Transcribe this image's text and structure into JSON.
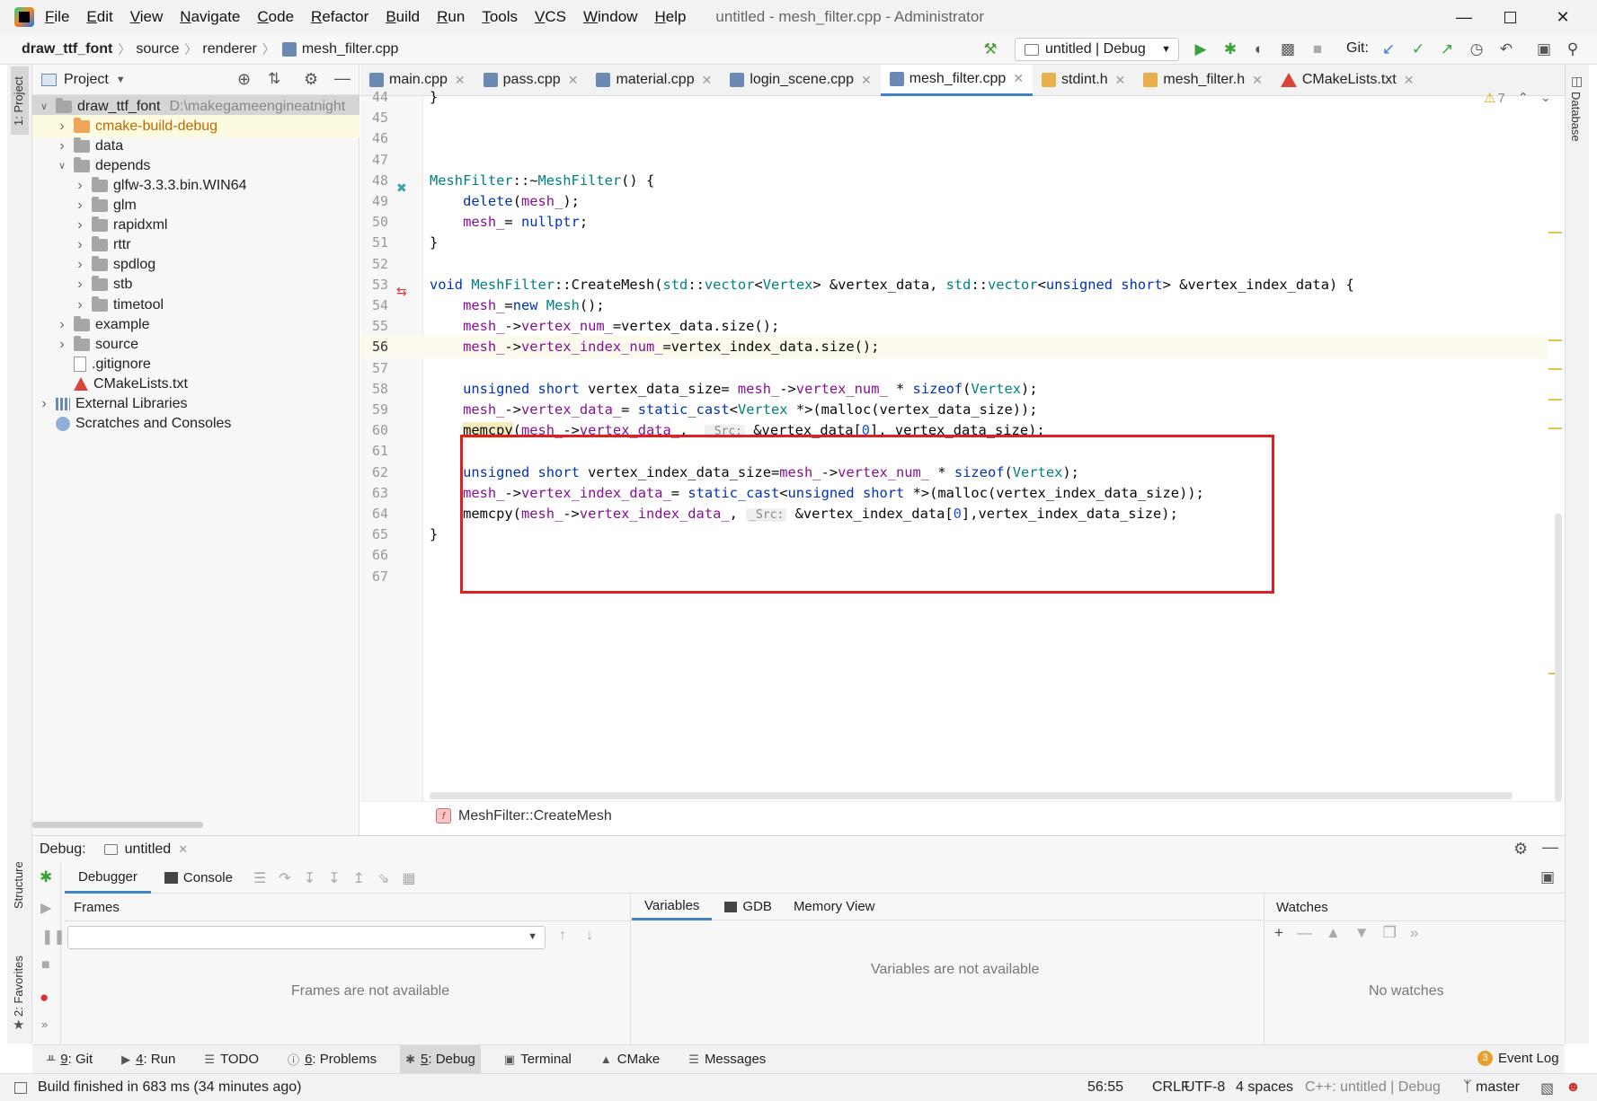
{
  "menu": [
    "File",
    "Edit",
    "View",
    "Navigate",
    "Code",
    "Refactor",
    "Build",
    "Run",
    "Tools",
    "VCS",
    "Window",
    "Help"
  ],
  "window_title": "untitled - mesh_filter.cpp - Administrator",
  "breadcrumbs": [
    "draw_ttf_font",
    "source",
    "renderer",
    "mesh_filter.cpp"
  ],
  "run_config": "untitled | Debug",
  "git_label": "Git:",
  "project_panel": {
    "title": "Project",
    "tree": [
      {
        "label": "draw_ttf_font",
        "path": "D:\\makegameengineatnight",
        "level": 0,
        "open": true,
        "kind": "root"
      },
      {
        "label": "cmake-build-debug",
        "level": 1,
        "open": false,
        "kind": "orange"
      },
      {
        "label": "data",
        "level": 1,
        "open": false,
        "kind": "folder"
      },
      {
        "label": "depends",
        "level": 1,
        "open": true,
        "kind": "folder"
      },
      {
        "label": "glfw-3.3.3.bin.WIN64",
        "level": 2,
        "open": false,
        "kind": "folder"
      },
      {
        "label": "glm",
        "level": 2,
        "open": false,
        "kind": "folder"
      },
      {
        "label": "rapidxml",
        "level": 2,
        "open": false,
        "kind": "folder"
      },
      {
        "label": "rttr",
        "level": 2,
        "open": false,
        "kind": "folder"
      },
      {
        "label": "spdlog",
        "level": 2,
        "open": false,
        "kind": "folder"
      },
      {
        "label": "stb",
        "level": 2,
        "open": false,
        "kind": "folder"
      },
      {
        "label": "timetool",
        "level": 2,
        "open": false,
        "kind": "folder"
      },
      {
        "label": "example",
        "level": 1,
        "open": false,
        "kind": "folder"
      },
      {
        "label": "source",
        "level": 1,
        "open": false,
        "kind": "folder"
      },
      {
        "label": ".gitignore",
        "level": 1,
        "kind": "file"
      },
      {
        "label": "CMakeLists.txt",
        "level": 1,
        "kind": "cmake"
      },
      {
        "label": "External Libraries",
        "level": 0,
        "open": false,
        "kind": "lib"
      },
      {
        "label": "Scratches and Consoles",
        "level": 0,
        "kind": "scratch"
      }
    ]
  },
  "tabs": [
    {
      "label": "main.cpp",
      "kind": "cpp"
    },
    {
      "label": "pass.cpp",
      "kind": "cpp"
    },
    {
      "label": "material.cpp",
      "kind": "cpp"
    },
    {
      "label": "login_scene.cpp",
      "kind": "cpp"
    },
    {
      "label": "mesh_filter.cpp",
      "kind": "cpp",
      "active": true
    },
    {
      "label": "stdint.h",
      "kind": "h"
    },
    {
      "label": "mesh_filter.h",
      "kind": "h"
    },
    {
      "label": "CMakeLists.txt",
      "kind": "cmake"
    }
  ],
  "editor": {
    "warning_count": "7",
    "lines": [
      {
        "n": "44",
        "code": "}"
      },
      {
        "n": "45",
        "code": ""
      },
      {
        "n": "46",
        "code": ""
      },
      {
        "n": "47",
        "code": ""
      },
      {
        "n": "48",
        "code": "MeshFilter::~MeshFilter() {"
      },
      {
        "n": "49",
        "code": "    delete(mesh_);"
      },
      {
        "n": "50",
        "code": "    mesh_= nullptr;"
      },
      {
        "n": "51",
        "code": "}"
      },
      {
        "n": "52",
        "code": ""
      },
      {
        "n": "53",
        "code": "void MeshFilter::CreateMesh(std::vector<Vertex> &vertex_data, std::vector<unsigned short> &vertex_index_data) {"
      },
      {
        "n": "54",
        "code": "    mesh_=new Mesh();"
      },
      {
        "n": "55",
        "code": "    mesh_->vertex_num_=vertex_data.size();"
      },
      {
        "n": "56",
        "code": "    mesh_->vertex_index_num_=vertex_index_data.size();"
      },
      {
        "n": "57",
        "code": ""
      },
      {
        "n": "58",
        "code": "    unsigned short vertex_data_size= mesh_->vertex_num_ * sizeof(Vertex);"
      },
      {
        "n": "59",
        "code": "    mesh_->vertex_data_= static_cast<Vertex *>(malloc(vertex_data_size));"
      },
      {
        "n": "60",
        "code": "    memcpy(mesh_->vertex_data_,  _Src: &vertex_data[0], vertex_data_size);"
      },
      {
        "n": "61",
        "code": ""
      },
      {
        "n": "62",
        "code": "    unsigned short vertex_index_data_size=mesh_->vertex_num_ * sizeof(Vertex);"
      },
      {
        "n": "63",
        "code": "    mesh_->vertex_index_data_= static_cast<unsigned short *>(malloc(vertex_index_data_size));"
      },
      {
        "n": "64",
        "code": "    memcpy(mesh_->vertex_index_data_, _Src: &vertex_index_data[0],vertex_index_data_size);"
      },
      {
        "n": "65",
        "code": "}"
      },
      {
        "n": "66",
        "code": ""
      },
      {
        "n": "67",
        "code": ""
      }
    ],
    "breadcrumb": "MeshFilter::CreateMesh"
  },
  "debug": {
    "label": "Debug:",
    "session": "untitled",
    "tabs": [
      "Debugger",
      "Console"
    ],
    "frames_title": "Frames",
    "frames_empty": "Frames are not available",
    "var_tabs": [
      "Variables",
      "GDB",
      "Memory View"
    ],
    "vars_empty": "Variables are not available",
    "watches_title": "Watches",
    "watches_empty": "No watches"
  },
  "tool_windows": [
    {
      "key": "9",
      "label": ": Git"
    },
    {
      "key": "4",
      "label": ": Run"
    },
    {
      "key": "",
      "label": "TODO"
    },
    {
      "key": "6",
      "label": ": Problems"
    },
    {
      "key": "5",
      "label": ": Debug",
      "active": true
    },
    {
      "key": "",
      "label": "Terminal"
    },
    {
      "key": "",
      "label": "CMake"
    },
    {
      "key": "",
      "label": "Messages"
    }
  ],
  "event_log": {
    "label": "Event Log",
    "count": "3"
  },
  "status": {
    "message": "Build finished in 683 ms (34 minutes ago)",
    "position": "56:55",
    "line_sep": "CRLF",
    "encoding": "UTF-8",
    "indent": "4 spaces",
    "context": "C++: untitled | Debug",
    "branch": "master"
  },
  "side_tabs": {
    "project": "1: Project",
    "structure": "Structure",
    "favorites": "2: Favorites",
    "database": "Database"
  }
}
